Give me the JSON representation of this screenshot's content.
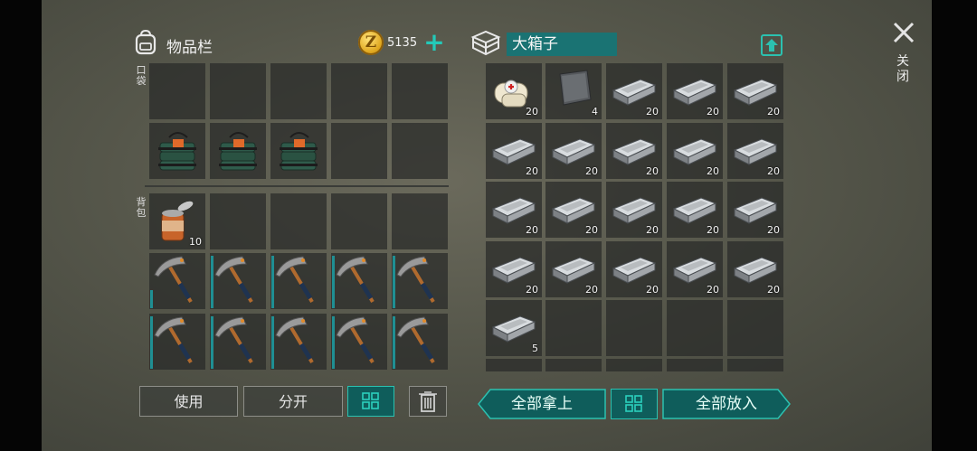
{
  "inventory": {
    "title": "物品栏",
    "coin_symbol": "Z",
    "money": "5135",
    "add_symbol": "+",
    "pocket_label": "口袋",
    "backpack_label": "背包",
    "pocket_items": [
      "grenade-bundle",
      "grenade-bundle",
      "grenade-bundle"
    ],
    "backpack_items": [
      {
        "icon": "canned-food",
        "qty": "10"
      }
    ],
    "pickaxe_count": 10
  },
  "container": {
    "name": "大箱子",
    "slots": [
      {
        "icon": "medkit-icon",
        "qty": "20"
      },
      {
        "icon": "metal-plate-icon",
        "qty": "4"
      },
      {
        "icon": "iron-ingot-icon",
        "qty": "20"
      },
      {
        "icon": "iron-ingot-icon",
        "qty": "20"
      },
      {
        "icon": "iron-ingot-icon",
        "qty": "20"
      },
      {
        "icon": "iron-ingot-icon",
        "qty": "20"
      },
      {
        "icon": "iron-ingot-icon",
        "qty": "20"
      },
      {
        "icon": "iron-ingot-icon",
        "qty": "20"
      },
      {
        "icon": "iron-ingot-icon",
        "qty": "20"
      },
      {
        "icon": "iron-ingot-icon",
        "qty": "20"
      },
      {
        "icon": "iron-ingot-icon",
        "qty": "20"
      },
      {
        "icon": "iron-ingot-icon",
        "qty": "20"
      },
      {
        "icon": "iron-ingot-icon",
        "qty": "20"
      },
      {
        "icon": "iron-ingot-icon",
        "qty": "20"
      },
      {
        "icon": "iron-ingot-icon",
        "qty": "20"
      },
      {
        "icon": "iron-ingot-icon",
        "qty": "20"
      },
      {
        "icon": "iron-ingot-icon",
        "qty": "20"
      },
      {
        "icon": "iron-ingot-icon",
        "qty": "20"
      },
      {
        "icon": "iron-ingot-icon",
        "qty": "20"
      },
      {
        "icon": "iron-ingot-icon",
        "qty": "20"
      },
      {
        "icon": "iron-ingot-icon",
        "qty": "5"
      }
    ]
  },
  "close_label": "关闭",
  "buttons": {
    "use": "使用",
    "split": "分开",
    "take_all": "全部拿上",
    "put_all": "全部放入"
  },
  "colors": {
    "accent": "#2bc1b0",
    "coin": "#e0a820",
    "slot": "#2a2c2a"
  }
}
